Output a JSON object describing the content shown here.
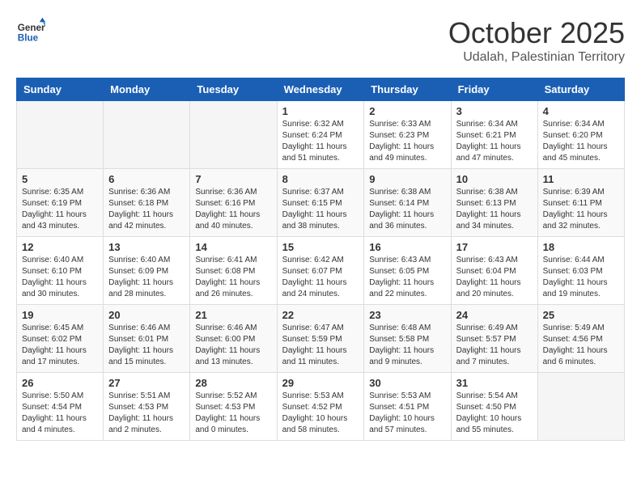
{
  "logo": {
    "text_general": "General",
    "text_blue": "Blue"
  },
  "title": "October 2025",
  "subtitle": "Udalah, Palestinian Territory",
  "days_of_week": [
    "Sunday",
    "Monday",
    "Tuesday",
    "Wednesday",
    "Thursday",
    "Friday",
    "Saturday"
  ],
  "weeks": [
    [
      {
        "day": "",
        "info": ""
      },
      {
        "day": "",
        "info": ""
      },
      {
        "day": "",
        "info": ""
      },
      {
        "day": "1",
        "info": "Sunrise: 6:32 AM\nSunset: 6:24 PM\nDaylight: 11 hours\nand 51 minutes."
      },
      {
        "day": "2",
        "info": "Sunrise: 6:33 AM\nSunset: 6:23 PM\nDaylight: 11 hours\nand 49 minutes."
      },
      {
        "day": "3",
        "info": "Sunrise: 6:34 AM\nSunset: 6:21 PM\nDaylight: 11 hours\nand 47 minutes."
      },
      {
        "day": "4",
        "info": "Sunrise: 6:34 AM\nSunset: 6:20 PM\nDaylight: 11 hours\nand 45 minutes."
      }
    ],
    [
      {
        "day": "5",
        "info": "Sunrise: 6:35 AM\nSunset: 6:19 PM\nDaylight: 11 hours\nand 43 minutes."
      },
      {
        "day": "6",
        "info": "Sunrise: 6:36 AM\nSunset: 6:18 PM\nDaylight: 11 hours\nand 42 minutes."
      },
      {
        "day": "7",
        "info": "Sunrise: 6:36 AM\nSunset: 6:16 PM\nDaylight: 11 hours\nand 40 minutes."
      },
      {
        "day": "8",
        "info": "Sunrise: 6:37 AM\nSunset: 6:15 PM\nDaylight: 11 hours\nand 38 minutes."
      },
      {
        "day": "9",
        "info": "Sunrise: 6:38 AM\nSunset: 6:14 PM\nDaylight: 11 hours\nand 36 minutes."
      },
      {
        "day": "10",
        "info": "Sunrise: 6:38 AM\nSunset: 6:13 PM\nDaylight: 11 hours\nand 34 minutes."
      },
      {
        "day": "11",
        "info": "Sunrise: 6:39 AM\nSunset: 6:11 PM\nDaylight: 11 hours\nand 32 minutes."
      }
    ],
    [
      {
        "day": "12",
        "info": "Sunrise: 6:40 AM\nSunset: 6:10 PM\nDaylight: 11 hours\nand 30 minutes."
      },
      {
        "day": "13",
        "info": "Sunrise: 6:40 AM\nSunset: 6:09 PM\nDaylight: 11 hours\nand 28 minutes."
      },
      {
        "day": "14",
        "info": "Sunrise: 6:41 AM\nSunset: 6:08 PM\nDaylight: 11 hours\nand 26 minutes."
      },
      {
        "day": "15",
        "info": "Sunrise: 6:42 AM\nSunset: 6:07 PM\nDaylight: 11 hours\nand 24 minutes."
      },
      {
        "day": "16",
        "info": "Sunrise: 6:43 AM\nSunset: 6:05 PM\nDaylight: 11 hours\nand 22 minutes."
      },
      {
        "day": "17",
        "info": "Sunrise: 6:43 AM\nSunset: 6:04 PM\nDaylight: 11 hours\nand 20 minutes."
      },
      {
        "day": "18",
        "info": "Sunrise: 6:44 AM\nSunset: 6:03 PM\nDaylight: 11 hours\nand 19 minutes."
      }
    ],
    [
      {
        "day": "19",
        "info": "Sunrise: 6:45 AM\nSunset: 6:02 PM\nDaylight: 11 hours\nand 17 minutes."
      },
      {
        "day": "20",
        "info": "Sunrise: 6:46 AM\nSunset: 6:01 PM\nDaylight: 11 hours\nand 15 minutes."
      },
      {
        "day": "21",
        "info": "Sunrise: 6:46 AM\nSunset: 6:00 PM\nDaylight: 11 hours\nand 13 minutes."
      },
      {
        "day": "22",
        "info": "Sunrise: 6:47 AM\nSunset: 5:59 PM\nDaylight: 11 hours\nand 11 minutes."
      },
      {
        "day": "23",
        "info": "Sunrise: 6:48 AM\nSunset: 5:58 PM\nDaylight: 11 hours\nand 9 minutes."
      },
      {
        "day": "24",
        "info": "Sunrise: 6:49 AM\nSunset: 5:57 PM\nDaylight: 11 hours\nand 7 minutes."
      },
      {
        "day": "25",
        "info": "Sunrise: 5:49 AM\nSunset: 4:56 PM\nDaylight: 11 hours\nand 6 minutes."
      }
    ],
    [
      {
        "day": "26",
        "info": "Sunrise: 5:50 AM\nSunset: 4:54 PM\nDaylight: 11 hours\nand 4 minutes."
      },
      {
        "day": "27",
        "info": "Sunrise: 5:51 AM\nSunset: 4:53 PM\nDaylight: 11 hours\nand 2 minutes."
      },
      {
        "day": "28",
        "info": "Sunrise: 5:52 AM\nSunset: 4:53 PM\nDaylight: 11 hours\nand 0 minutes."
      },
      {
        "day": "29",
        "info": "Sunrise: 5:53 AM\nSunset: 4:52 PM\nDaylight: 10 hours\nand 58 minutes."
      },
      {
        "day": "30",
        "info": "Sunrise: 5:53 AM\nSunset: 4:51 PM\nDaylight: 10 hours\nand 57 minutes."
      },
      {
        "day": "31",
        "info": "Sunrise: 5:54 AM\nSunset: 4:50 PM\nDaylight: 10 hours\nand 55 minutes."
      },
      {
        "day": "",
        "info": ""
      }
    ]
  ]
}
